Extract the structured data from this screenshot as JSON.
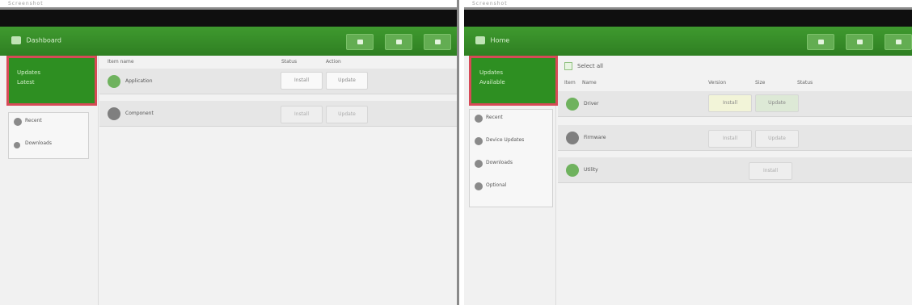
{
  "colors": {
    "green": "#2f8b25",
    "highlight": "#d74a57",
    "dark": "#0f0f0f",
    "panel": "#f2f2f2"
  },
  "left": {
    "caption": "Screenshot",
    "brand": "Dashboard",
    "feature": {
      "title": "Updates",
      "subtitle": "Latest"
    },
    "nav": [
      {
        "label": "Recent",
        "sub": ""
      },
      {
        "label": "Downloads",
        "sub": ""
      }
    ],
    "columns": [
      "Item name",
      "Status",
      "Action"
    ],
    "rows": [
      {
        "label": "Application",
        "icon": "app-icon",
        "state": [
          "Install",
          "Update"
        ]
      },
      {
        "label": "Component",
        "icon": "component-icon",
        "state": [
          "Install",
          "Update"
        ]
      }
    ]
  },
  "right": {
    "caption": "Screenshot",
    "brand": "Home",
    "feature": {
      "title": "Updates",
      "subtitle": "Available"
    },
    "select_all": "Select all",
    "nav": [
      {
        "label": "Recent",
        "sub": ""
      },
      {
        "label": "Device Updates",
        "sub": ""
      },
      {
        "label": "Downloads",
        "sub": ""
      },
      {
        "label": "Optional",
        "sub": ""
      }
    ],
    "columns": [
      "Item",
      "Name",
      "Version",
      "Size",
      "Status"
    ],
    "rows": [
      {
        "label": "Driver",
        "icon": "driver-icon",
        "state": [
          "Install",
          "Update"
        ]
      },
      {
        "label": "Firmware",
        "icon": "firmware-icon",
        "state": [
          "Install",
          "Update"
        ]
      },
      {
        "label": "Utility",
        "icon": "utility-icon",
        "state": [
          "Install"
        ]
      }
    ]
  }
}
